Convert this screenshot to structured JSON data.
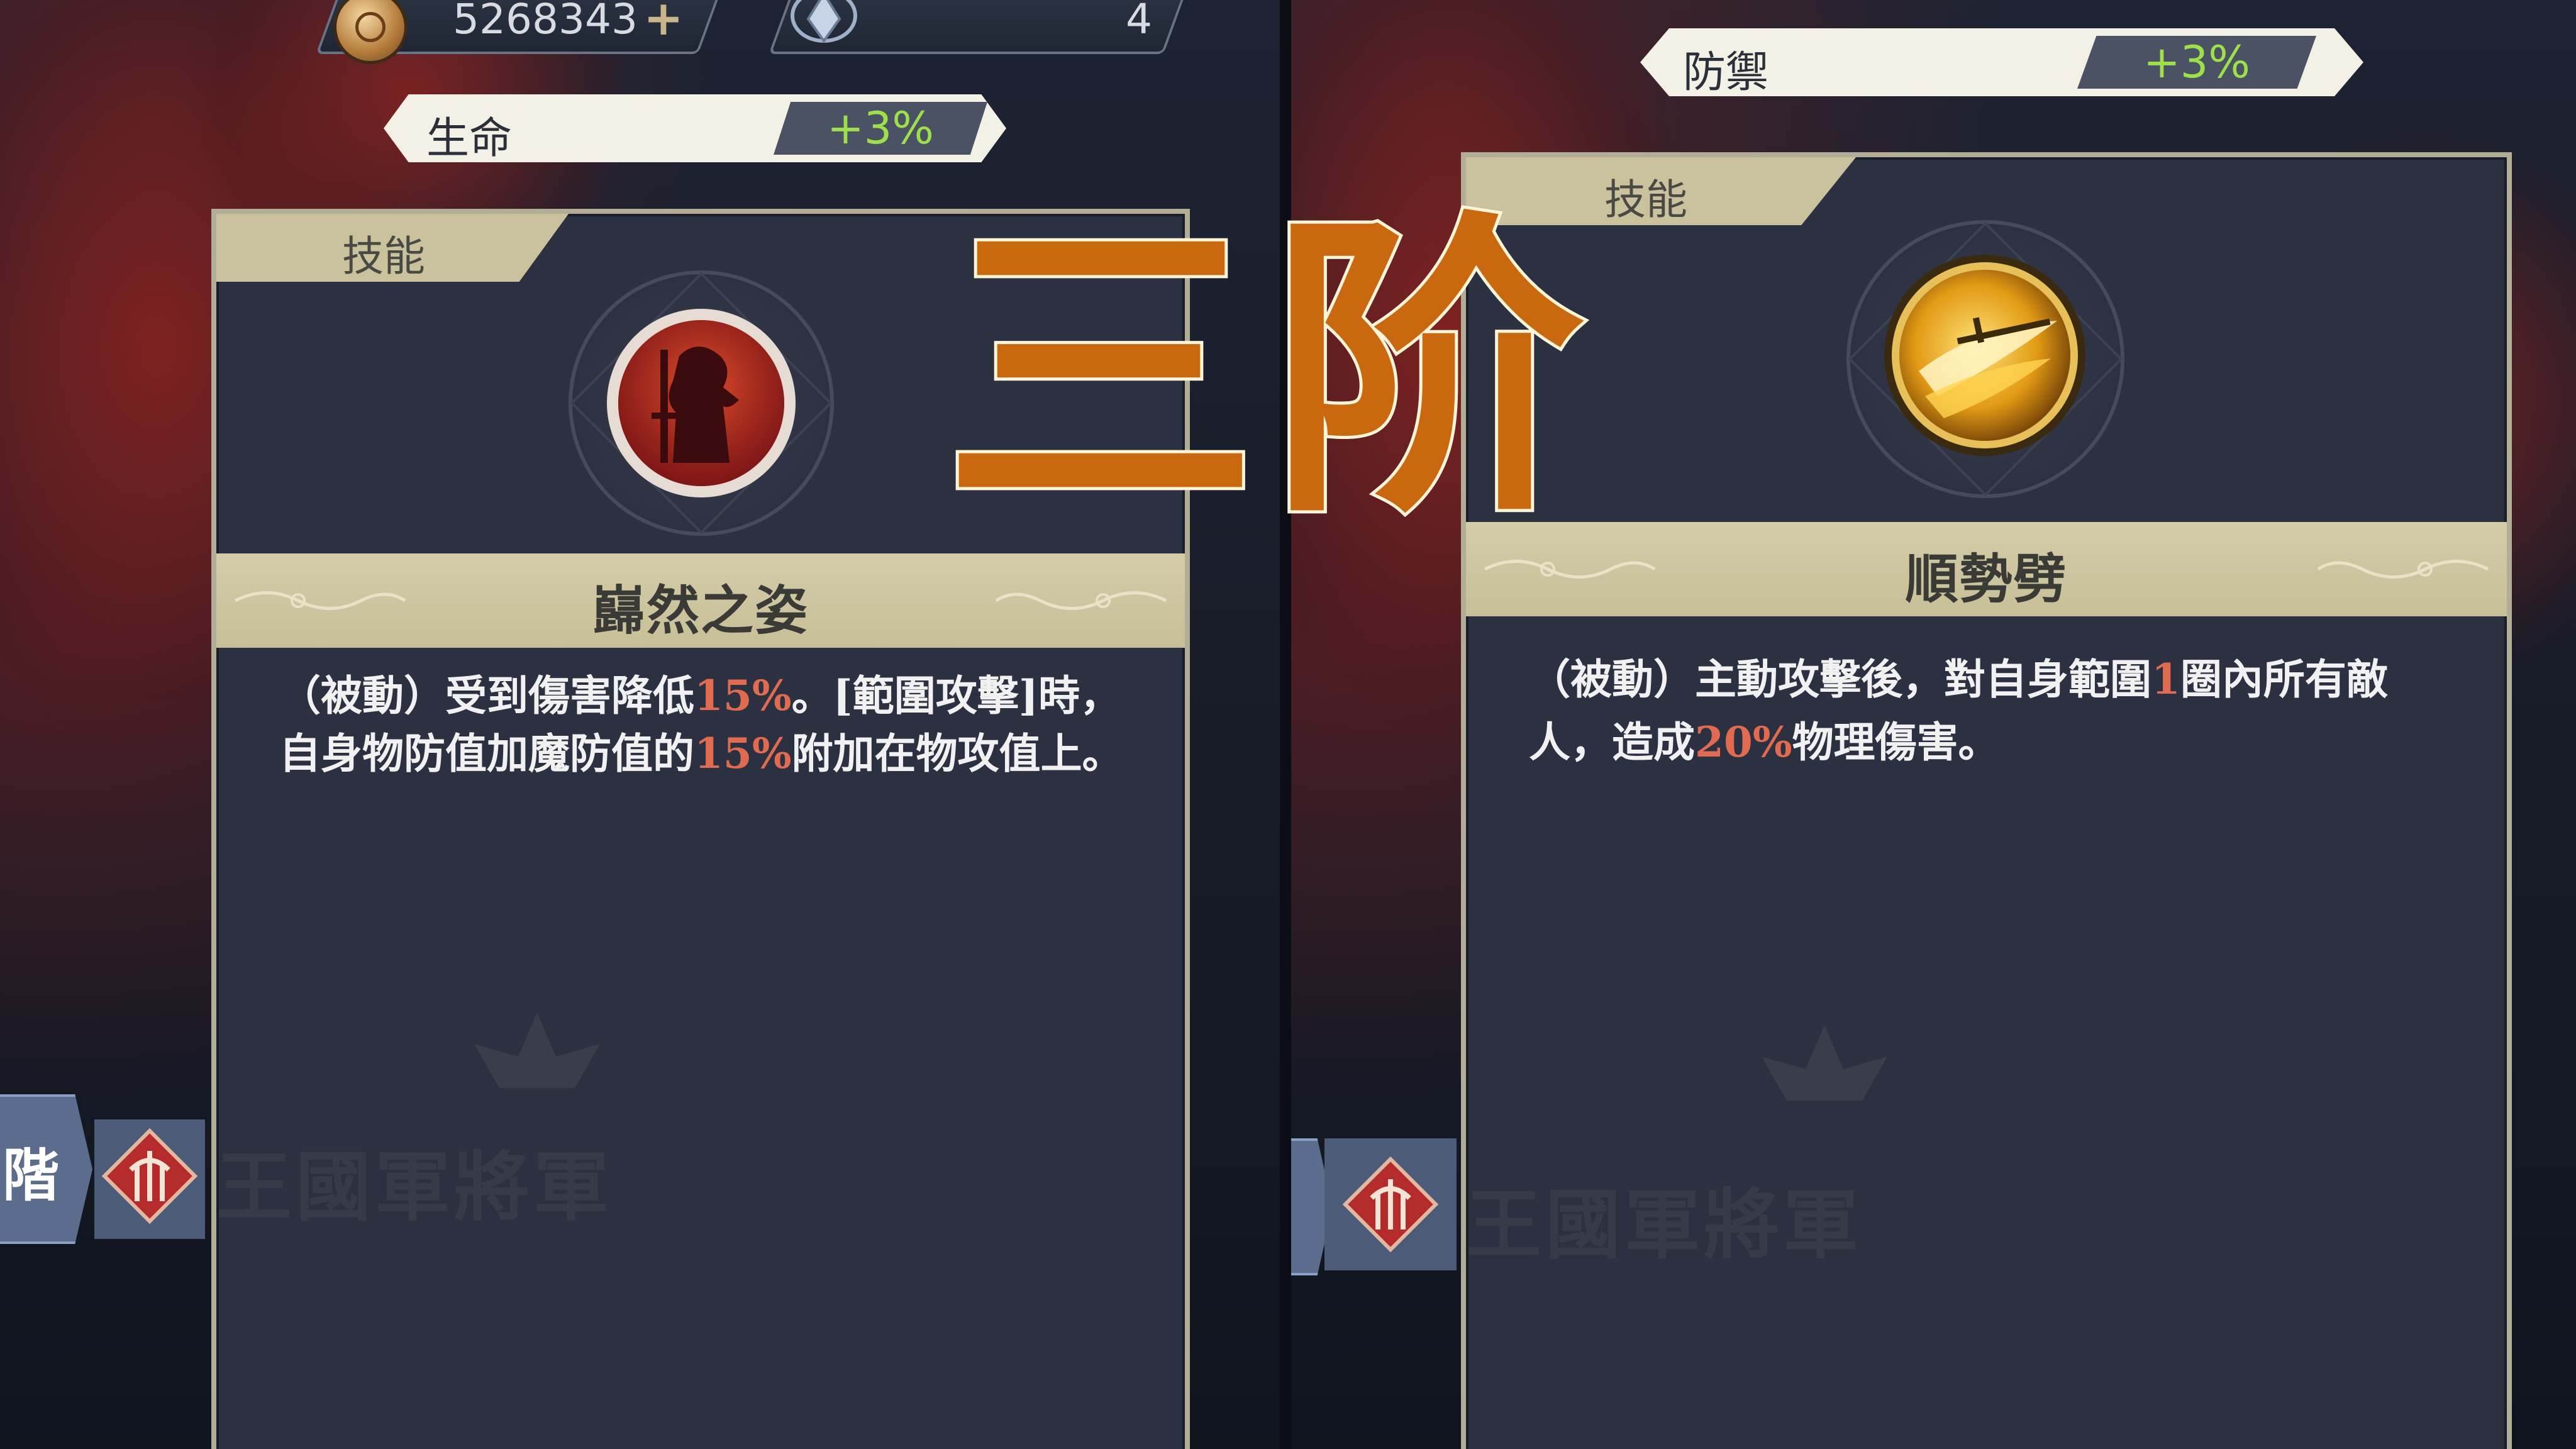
{
  "overlay": {
    "title": "三阶"
  },
  "left": {
    "gold_amount": "5268343",
    "gem_amount": "4",
    "stat": {
      "label": "生命",
      "value": "+3%"
    },
    "tab": "技能",
    "skill_name": "巋然之姿",
    "description_parts": [
      "（被動）受到傷害降低",
      "15%",
      "。[範圍攻擊]時，自身物防值加魔防值的",
      "15%",
      "附加在物攻值上。"
    ],
    "rank_text": "階",
    "watermark": "王國軍將軍"
  },
  "right": {
    "stat": {
      "label": "防禦",
      "value": "+3%"
    },
    "tab": "技能",
    "skill_name": "順勢劈",
    "description_parts": [
      "（被動）主動攻擊後，對自身範圍",
      "1",
      "圈內所有敵人，造成",
      "20%",
      "物理傷害。"
    ],
    "watermark": "王國軍將軍"
  },
  "colors": {
    "panel_bg": "#2c3141",
    "band": "#cdc6a2",
    "highlight": "#e06b50",
    "stat_value": "#9de04c",
    "title_fill": "#c9680e",
    "title_stroke": "#ff8a1f"
  },
  "icons": {
    "gold": "coin-icon",
    "gem": "crystal-icon",
    "add": "plus-icon",
    "skill_left": "warrior-silhouette-icon",
    "skill_right": "sword-slash-icon",
    "rank": "army-crest-icon"
  }
}
